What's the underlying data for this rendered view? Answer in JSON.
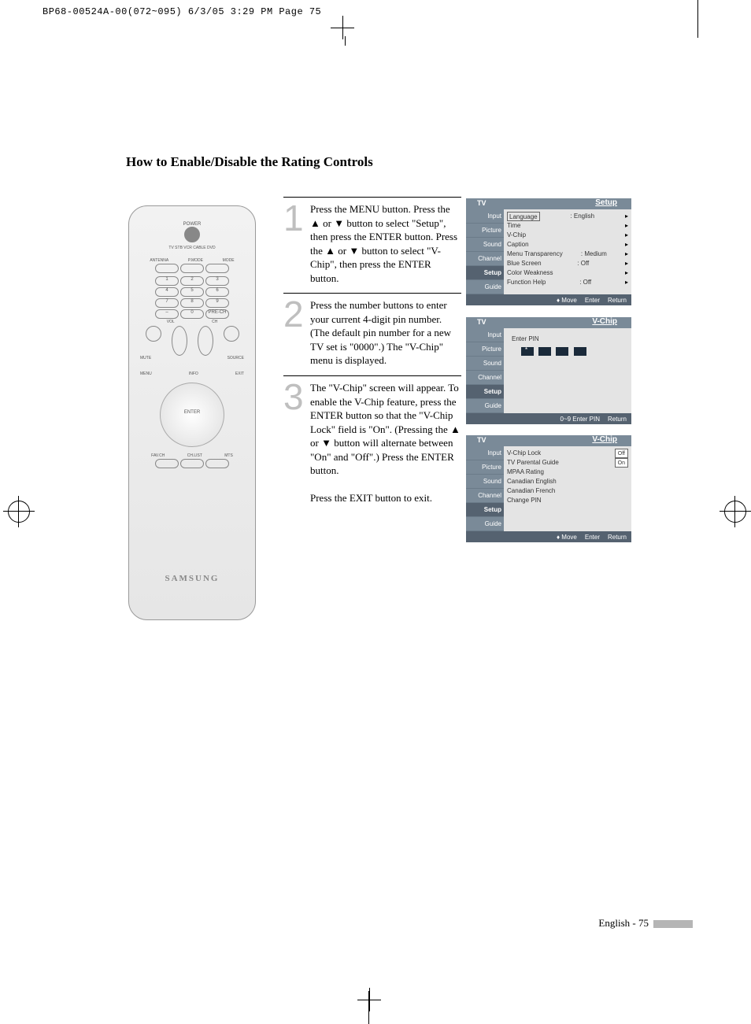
{
  "print_header": "BP68-00524A-00(072~095)  6/3/05  3:29 PM  Page 75",
  "title": "How to Enable/Disable the Rating Controls",
  "remote": {
    "power": "POWER",
    "modes": "TV  STB  VCR  CABLE  DVD",
    "row1": [
      "ANTENNA",
      "P.MODE",
      "MODE"
    ],
    "mute": "MUTE",
    "source": "SOURCE",
    "vol": "VOL",
    "ch": "CH",
    "menu": "MENU",
    "exit": "EXIT",
    "info": "INFO",
    "enter": "ENTER",
    "favch": "FAV.CH",
    "chlist": "CH.LIST",
    "mts": "MTS",
    "prech": "PRE-CH",
    "brand": "SAMSUNG"
  },
  "steps": [
    {
      "n": "1",
      "text": "Press the MENU button. Press the ▲ or ▼ button to select \"Setup\", then press the ENTER button. Press the ▲ or ▼ button to select \"V-Chip\", then press the ENTER button."
    },
    {
      "n": "2",
      "text": "Press the number buttons to enter your current 4-digit pin number. (The default pin number for a new TV set is \"0000\".) The \"V-Chip\" menu is displayed."
    },
    {
      "n": "3",
      "text": "The \"V-Chip\" screen will appear. To enable the V-Chip feature, press the ENTER button so that the \"V-Chip Lock\" field is \"On\". (Pressing the ▲ or ▼ button will alternate between \"On\" and \"Off\".) Press the ENTER button.",
      "extra": "Press the EXIT button to exit."
    }
  ],
  "osd_side": [
    "Input",
    "Picture",
    "Sound",
    "Channel",
    "Setup",
    "Guide"
  ],
  "osd1": {
    "title": "Setup",
    "rows": [
      {
        "l": "Language",
        "r": ": English"
      },
      {
        "l": "Time",
        "r": ""
      },
      {
        "l": "V-Chip",
        "r": ""
      },
      {
        "l": "Caption",
        "r": ""
      },
      {
        "l": "Menu Transparency",
        "r": ": Medium"
      },
      {
        "l": "Blue Screen",
        "r": ": Off"
      },
      {
        "l": "Color Weakness",
        "r": ""
      },
      {
        "l": "Function Help",
        "r": ": Off"
      }
    ],
    "ftr": [
      "Move",
      "Enter",
      "Return"
    ]
  },
  "osd2": {
    "title": "V-Chip",
    "label": "Enter PIN",
    "ftr": [
      "0~9 Enter PIN",
      "Return"
    ]
  },
  "osd3": {
    "title": "V-Chip",
    "rows": [
      {
        "l": "V-Chip Lock",
        "r": "Off"
      },
      {
        "l": "TV Parental Guide",
        "r": "On"
      },
      {
        "l": "MPAA Rating",
        "r": ""
      },
      {
        "l": "Canadian English",
        "r": ""
      },
      {
        "l": "Canadian French",
        "r": ""
      },
      {
        "l": "Change PIN",
        "r": ""
      }
    ],
    "ftr": [
      "Move",
      "Enter",
      "Return"
    ]
  },
  "footer": {
    "lang": "English",
    "page": "75"
  }
}
